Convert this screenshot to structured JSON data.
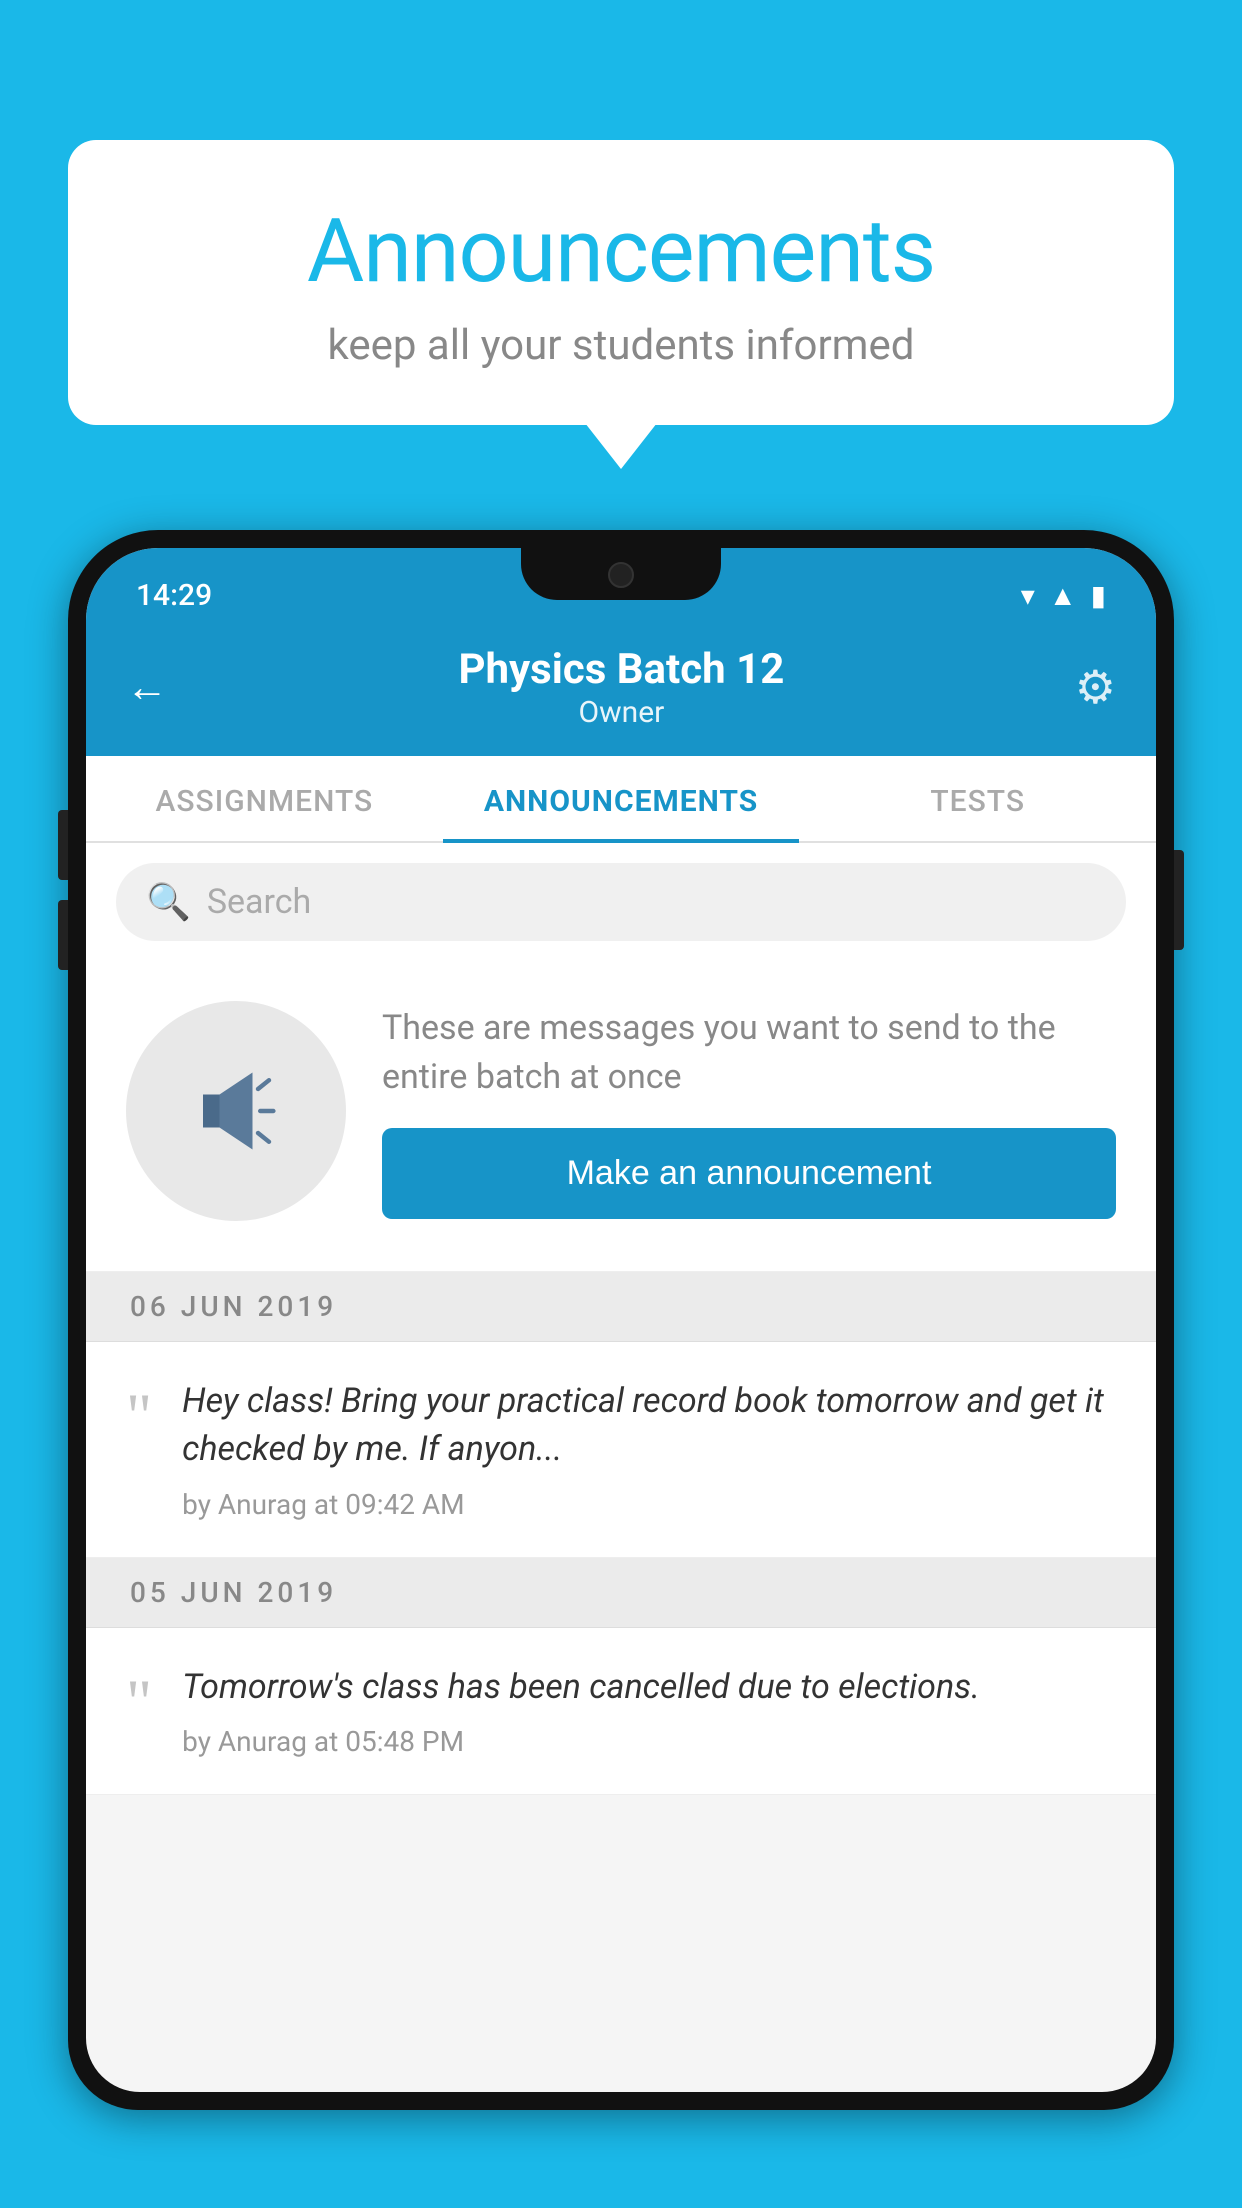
{
  "bubble": {
    "title": "Announcements",
    "subtitle": "keep all your students informed"
  },
  "status_bar": {
    "time": "14:29"
  },
  "header": {
    "title": "Physics Batch 12",
    "subtitle": "Owner"
  },
  "tabs": [
    {
      "label": "ASSIGNMENTS",
      "active": false
    },
    {
      "label": "ANNOUNCEMENTS",
      "active": true
    },
    {
      "label": "TESTS",
      "active": false
    }
  ],
  "search": {
    "placeholder": "Search"
  },
  "prompt": {
    "description": "These are messages you want to send to the entire batch at once",
    "button_label": "Make an announcement"
  },
  "announcements": [
    {
      "date": "06  JUN  2019",
      "text": "Hey class! Bring your practical record book tomorrow and get it checked by me. If anyon...",
      "meta": "by Anurag at 09:42 AM"
    },
    {
      "date": "05  JUN  2019",
      "text": "Tomorrow's class has been cancelled due to elections.",
      "meta": "by Anurag at 05:48 PM"
    }
  ],
  "colors": {
    "primary": "#1794c8",
    "background": "#1ab8e8",
    "white": "#ffffff"
  }
}
